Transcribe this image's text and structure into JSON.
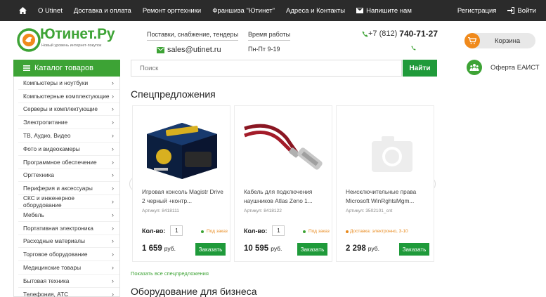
{
  "topnav": {
    "items": [
      "О Utinet",
      "Доставка и оплата",
      "Ремонт оргтехники",
      "Франшиза \"Ютинет\"",
      "Адреса и Контакты",
      "Напишите нам"
    ],
    "register": "Регистрация",
    "login": "Войти"
  },
  "header": {
    "logo_text": "Ютинет.Ру",
    "logo_tagline": "Новый уровень интернет-покупок",
    "supplies_caption": "Поставки, снабжение, тендеры",
    "email": "sales@utinet.ru",
    "hours_caption": "Время работы",
    "hours": "Пн-Пт 9-19",
    "phone_prefix": "+7 (812)",
    "phone_number": "740-71-27",
    "cart_label": "Корзина",
    "eaist_label": "Оферта ЕАИСТ"
  },
  "catalog": {
    "title": "Каталог товаров",
    "items": [
      "Компьютеры и ноутбуки",
      "Компьютерные комплектующие",
      "Серверы и комплектующие",
      "Электропитание",
      "ТВ, Аудио, Видео",
      "Фото и видеокамеры",
      "Программное обеспечение",
      "Оргтехника",
      "Периферия и аксессуары",
      "СКС и инженерное оборудование",
      "Мебель",
      "Портативная электроника",
      "Расходные материалы",
      "Торговое оборудование",
      "Медицинские товары",
      "Бытовая техника",
      "Телефония, АТС"
    ]
  },
  "search": {
    "placeholder": "Поиск",
    "button": "Найти"
  },
  "specials": {
    "title": "Спецпредложения",
    "show_all": "Показать все спецпредложения",
    "qty_label": "Кол-во:",
    "currency": "руб.",
    "buy_label": "Заказать",
    "products": [
      {
        "name": "Игровая консоль Magistr Drive 2 черный +контр...",
        "article": "Артикул: 8418111",
        "qty": "1",
        "availability": "Под заказ",
        "price": "1 659"
      },
      {
        "name": "Кабель для подключения наушников Atlas Zeno 1...",
        "article": "Артикул: 8418122",
        "qty": "1",
        "availability": "Под заказ",
        "price": "10 595"
      },
      {
        "name": "Неисключительные права Microsoft WinRghtsMgm...",
        "article": "Артикул: 3502101_cnt",
        "qty": "",
        "availability": "Доставка: электронно, 3-10",
        "price": "2 298"
      }
    ]
  },
  "business_title": "Оборудование для бизнеса",
  "colors": {
    "brand_green": "#3da335",
    "button_green": "#1f9a3a",
    "topbar": "#2b2b2b",
    "orange": "#f08a1c"
  }
}
